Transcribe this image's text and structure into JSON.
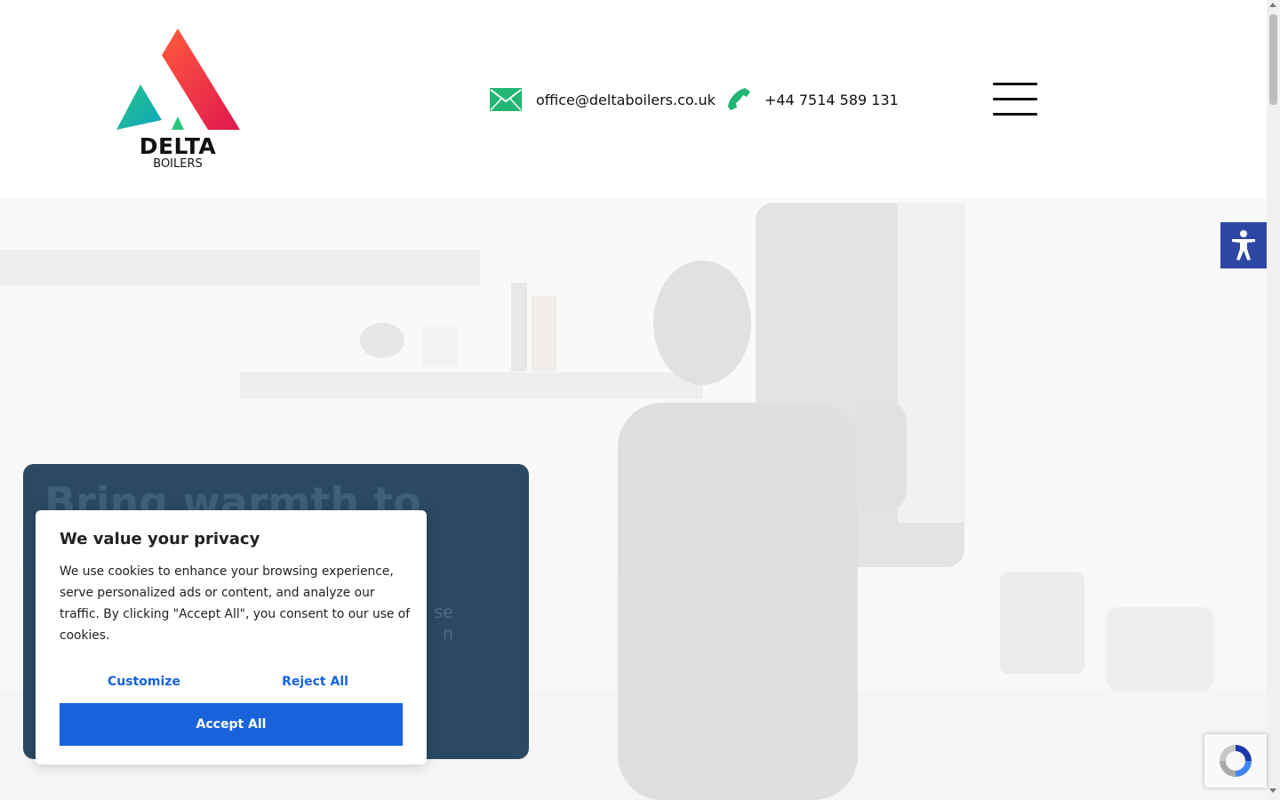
{
  "brand": {
    "name": "DELTA",
    "tagline": "BOILERS",
    "colors": {
      "red": "#f4533b",
      "teal": "#1ab5b0",
      "green": "#2bc67e",
      "dark": "#111111"
    }
  },
  "header": {
    "email": "office@deltaboilers.co.uk",
    "email_icon": "mail-icon",
    "phone": "+44 7514 589 131",
    "phone_icon": "phone-icon",
    "menu_icon": "hamburger-menu-icon",
    "icon_color": "#22b573"
  },
  "hero": {
    "headline": "Bring warmth to",
    "subtext": "se\nn",
    "card_color": "#2b4962"
  },
  "accessibility": {
    "icon": "accessibility-icon",
    "color": "#2f47a4"
  },
  "recaptcha": {
    "icon": "recaptcha-icon"
  },
  "cookie_banner": {
    "title": "We value your privacy",
    "body": "We use cookies to enhance your browsing experience, serve personalized ads or content, and analyze our traffic. By clicking \"Accept All\", you consent to our use of cookies.",
    "customize_label": "Customize",
    "reject_label": "Reject All",
    "accept_label": "Accept All",
    "accent_color": "#1863dc"
  }
}
